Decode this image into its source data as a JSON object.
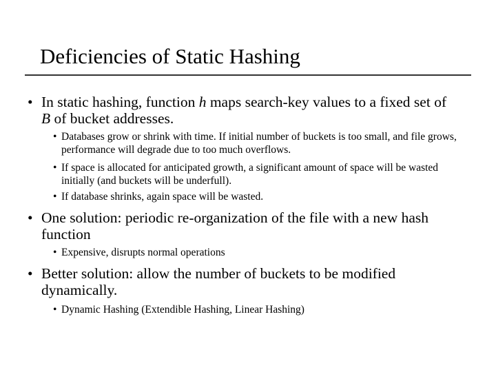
{
  "slide": {
    "title": "Deficiencies of Static Hashing",
    "bullets": [
      {
        "pre": "In static hashing, function ",
        "var1": "h",
        "mid": " maps search-key values to a fixed set of ",
        "var2": "B",
        "post": " of bucket addresses.",
        "sub": [
          "Databases grow or shrink with time. If initial number of buckets is too small, and file grows, performance will degrade due to too much overflows.",
          "If space is allocated for anticipated growth, a significant amount of space will be wasted initially (and buckets will be underfull).",
          "If database shrinks, again space will be wasted."
        ]
      },
      {
        "text": "One solution: periodic re-organization of the file with a new hash function",
        "sub": [
          "Expensive, disrupts normal operations"
        ]
      },
      {
        "text": "Better solution: allow the number of buckets to be modified dynamically.",
        "sub": [
          "Dynamic Hashing (Extendible Hashing, Linear Hashing)"
        ]
      }
    ],
    "bullet_glyph": "•"
  }
}
